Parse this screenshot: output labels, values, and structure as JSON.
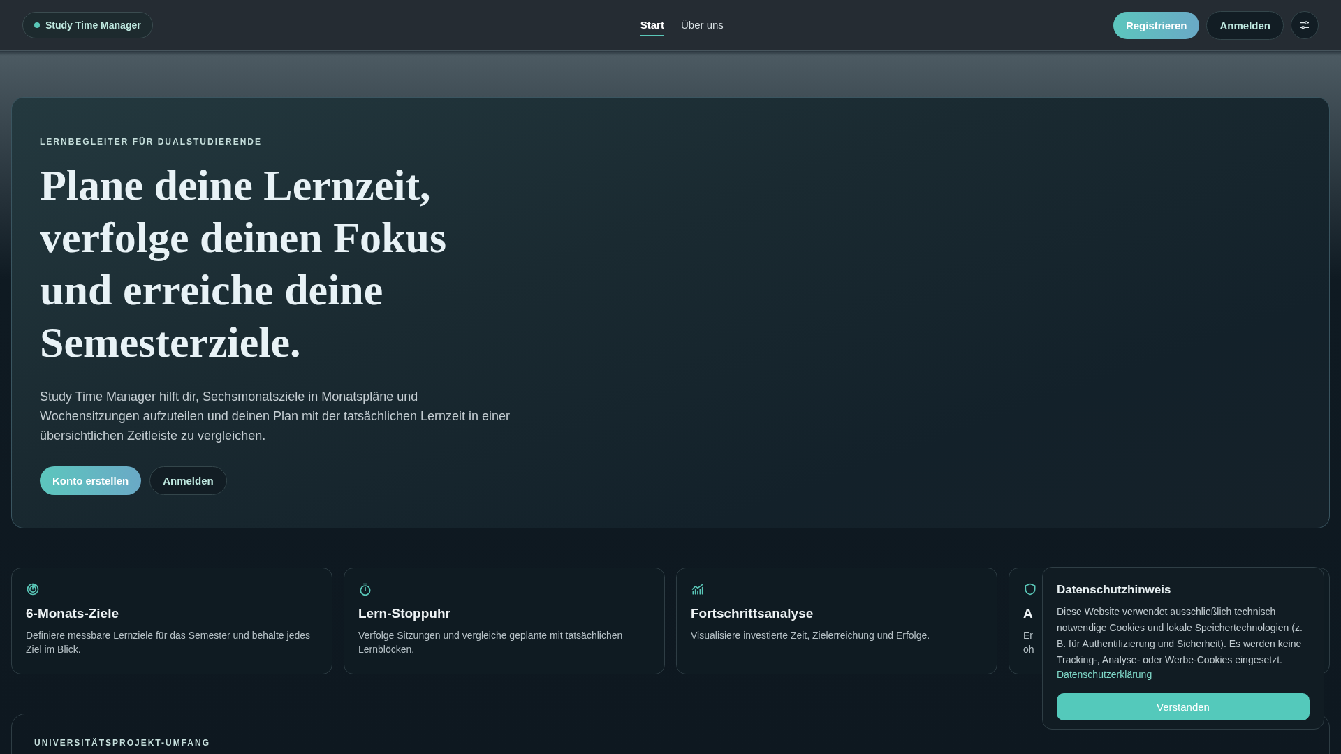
{
  "header": {
    "brand": "Study Time Manager",
    "nav": [
      {
        "label": "Start",
        "selected": true
      },
      {
        "label": "Über uns",
        "selected": false
      }
    ],
    "buttons": [
      {
        "label": "Registrieren",
        "kind": "primary"
      },
      {
        "label": "Anmelden",
        "kind": "outline"
      }
    ]
  },
  "hero": {
    "eyebrow": "LERNBEGLEITER FÜR DUALSTUDIERENDE",
    "title": "Plane deine Lernzeit, verfolge deinen Fokus und erreiche deine Semesterziele.",
    "text": "Study Time Manager hilft dir, Sechsmonatsziele in Monatspläne und Wochensitzungen aufzuteilen und deinen Plan mit der tatsächlichen Lernzeit in einer übersichtlichen Zeitleiste zu vergleichen.",
    "buttons": [
      {
        "label": "Konto erstellen",
        "kind": "primary"
      },
      {
        "label": "Anmelden",
        "kind": "outline"
      }
    ]
  },
  "features": [
    {
      "title": "6-Monats-Ziele",
      "lines": [
        "Definiere messbare Lernziele für das Semester und behalte jedes Ziel im Blick."
      ]
    },
    {
      "title": "Lern-Stoppuhr",
      "lines": [
        "Verfolge Sitzungen und vergleiche geplante mit tatsächlichen Lernblöcken."
      ]
    },
    {
      "title": "Fortschrittsanalyse",
      "lines": [
        "Visualisiere investierte Zeit, Zielerreichung und Erfolge."
      ]
    },
    {
      "title": "A",
      "lines": [
        "Er",
        "oh"
      ]
    }
  ],
  "scope": {
    "eyebrow": "UNIVERSITÄTSPROJEKT-UMFANG"
  },
  "cookie": {
    "title": "Datenschutzhinweis",
    "text": "Diese Website verwendet ausschließlich technisch notwendige Cookies und lokale Speichertechnologien (z. B. für Authentifizierung und Sicherheit). Es werden keine Tracking-, Analyse- oder Werbe-Cookies eingesetzt.",
    "link": "Datenschutzerklärung",
    "button": "Verstanden"
  }
}
